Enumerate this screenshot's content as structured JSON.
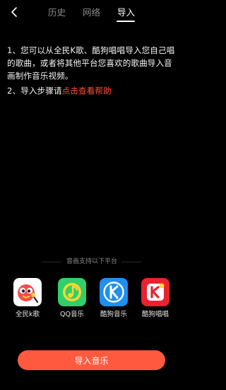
{
  "header": {
    "tabs": [
      {
        "label": "历史",
        "active": false
      },
      {
        "label": "网络",
        "active": false
      },
      {
        "label": "导入",
        "active": true
      }
    ],
    "back_icon": "chevron-left-icon"
  },
  "content": {
    "para1": "1、您可以从全民K歌、酷狗唱唱导入您自己唱的歌曲，或者将其他平台您喜欢的歌曲导入音画制作音乐视频。",
    "para2_prefix": "2、导入步骤请",
    "para2_link": "点击查看帮助"
  },
  "platforms": {
    "heading": "音画支持以下平台",
    "items": [
      {
        "label": "全民k歌",
        "icon": "quanmin-kge-icon"
      },
      {
        "label": "QQ音乐",
        "icon": "qq-music-icon"
      },
      {
        "label": "酷狗音乐",
        "icon": "kugou-music-icon"
      },
      {
        "label": "酷狗唱唱",
        "icon": "kugou-changchang-icon"
      }
    ]
  },
  "action": {
    "import_label": "导入音乐"
  },
  "colors": {
    "background": "#000000",
    "accent": "#ff5a3f",
    "link": "#ff4d3a"
  }
}
